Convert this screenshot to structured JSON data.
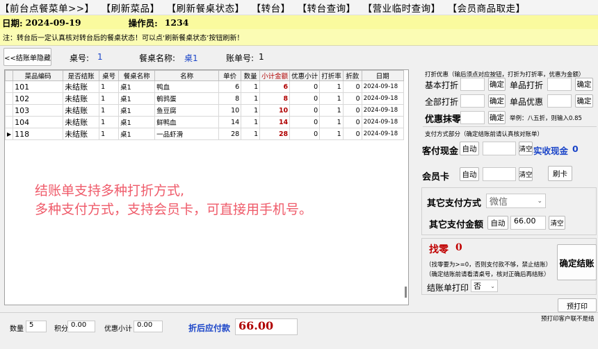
{
  "menu": [
    "【前台点餐菜单>>】",
    "【刷新菜品】",
    "【刷新餐桌状态】",
    "【转台】",
    "【转台查询】",
    "【营业临时查询】",
    "【会员商品取走】"
  ],
  "date_label": "日期:",
  "date_value": "2024-09-19",
  "operator_label": "操作员:",
  "operator_value": "1234",
  "notice": "注：转台后一定认真核对转台后的餐桌状态！可以点‘刷新餐桌状态’按钮刷新！",
  "bill_hide_button": "<<结账单隐藏",
  "table_no_label": "桌号:",
  "table_no_value": "1",
  "table_name_label": "餐桌名称:",
  "table_name_value": "桌1",
  "bill_no_label": "账单号:",
  "bill_no_value": "1",
  "grid": {
    "columns": [
      "菜品编码",
      "是否结账",
      "桌号",
      "餐桌名称",
      "名称",
      "单价",
      "数量",
      "小计金额",
      "优惠小计",
      "打折率",
      "折款",
      "日期"
    ],
    "rows": [
      [
        "101",
        "未结账",
        "1",
        "桌1",
        "鸭血",
        "6",
        "1",
        "6",
        "0",
        "1",
        "0",
        "2024-09-18"
      ],
      [
        "102",
        "未结账",
        "1",
        "桌1",
        "鹌鹑蛋",
        "8",
        "1",
        "8",
        "0",
        "1",
        "0",
        "2024-09-18"
      ],
      [
        "103",
        "未结账",
        "1",
        "桌1",
        "鱼豆腐",
        "10",
        "1",
        "10",
        "0",
        "1",
        "0",
        "2024-09-18"
      ],
      [
        "104",
        "未结账",
        "1",
        "桌1",
        "鲜鸭血",
        "14",
        "1",
        "14",
        "0",
        "1",
        "0",
        "2024-09-18"
      ],
      [
        "118",
        "未结账",
        "1",
        "桌1",
        "一品虾滑",
        "28",
        "1",
        "28",
        "0",
        "1",
        "0",
        "2024-09-18"
      ]
    ]
  },
  "promo_line1": "结账单支持多种打折方式,",
  "promo_line2": "多种支付方式，支持会员卡，可直接用手机号。",
  "footer": {
    "qty_label": "数量",
    "qty_value": "5",
    "points_label": "积分",
    "points_value": "0.00",
    "disc_sub_label": "优惠小计",
    "disc_sub_value": "0.00",
    "payable_label": "折后应付款",
    "payable_value": "66.00"
  },
  "discount": {
    "header": "打折优惠（输后须点对应按钮，打折为打折率，优惠为金额）",
    "basic_label": "基本打折",
    "single_disc_label": "单品打折",
    "whole_label": "全部打折",
    "single_promo_label": "单品优惠",
    "round_label": "优惠抹零",
    "confirm": "确定",
    "example": "举例：八五折，则输入0.85"
  },
  "payment": {
    "header": "支付方式部分（确定结账前请认真核对账单）",
    "cash_label": "客付现金",
    "auto": "自动",
    "clear": "清空",
    "received_label": "实收现金",
    "received_value": "0",
    "member_label": "会员卡",
    "swipe": "刷卡",
    "other_label": "其它支付方式",
    "other_selected": "微信",
    "other_amount_label": "其它支付金额",
    "other_amount_value": "66.00"
  },
  "change": {
    "label": "找零",
    "value": "0",
    "note1": "（找零要为>=0，否则支付款不够，禁止结账）",
    "note2": "（确定结账前请看清桌号，核对正确后再结账）",
    "print_label": "结账单打印",
    "print_selected": "否",
    "confirm_checkout": "确定结账"
  },
  "preprint_button": "预打印",
  "preprint_note": "预打印客户联不是结"
}
